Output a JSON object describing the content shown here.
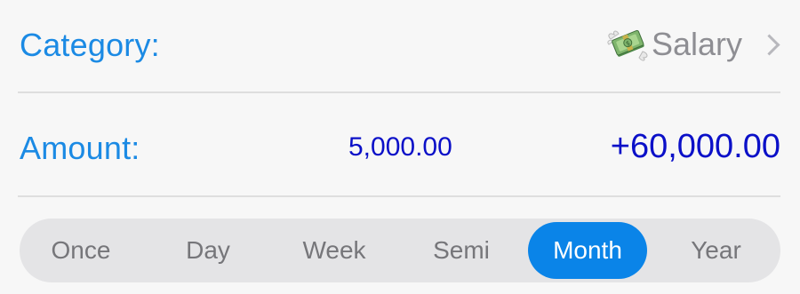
{
  "category": {
    "label": "Category:",
    "value": "Salary",
    "icon": "money-with-wings-icon"
  },
  "amount": {
    "label": "Amount:",
    "base_value": "5,000.00",
    "total_value": "+60,000.00"
  },
  "frequency": {
    "options": [
      "Once",
      "Day",
      "Week",
      "Semi",
      "Month",
      "Year"
    ],
    "selected": "Month"
  },
  "colors": {
    "label": "#1b8ae4",
    "amount": "#0b10c8",
    "selected_segment": "#0a84e8",
    "segment_background": "#e4e4e6"
  }
}
